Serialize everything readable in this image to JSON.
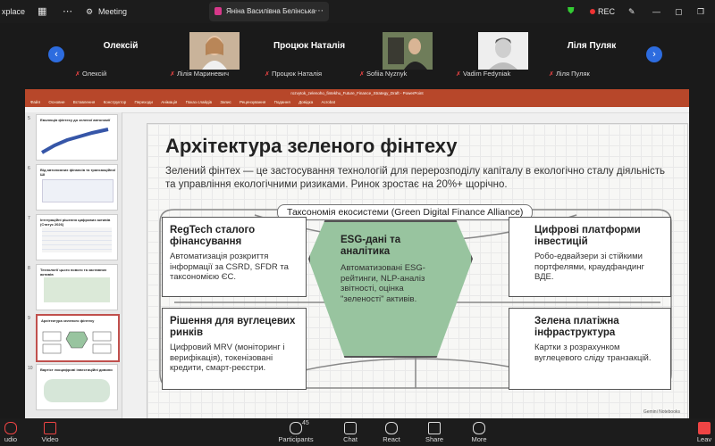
{
  "topbar": {
    "app_name": "xplace",
    "meeting_label": "Meeting",
    "tab_title": "Яніна Василівна Белінська's scr",
    "rec_label": "REC"
  },
  "gallery": {
    "participants": [
      {
        "name": "Олексій",
        "label": "Олексій",
        "has_photo": false
      },
      {
        "name": "",
        "label": "Лілія Мариневич",
        "has_photo": true
      },
      {
        "name": "Процюк Наталія",
        "label": "Процюк Наталія",
        "has_photo": false
      },
      {
        "name": "",
        "label": "Sofiia Nyznyk",
        "has_photo": true
      },
      {
        "name": "",
        "label": "Vadim Fedyniak",
        "has_photo": true
      },
      {
        "name": "Ліля Пуляк",
        "label": "Ліля Пуляк",
        "has_photo": false
      }
    ]
  },
  "ppt": {
    "title_bar": "rozvytok_zelenoho_fintekhu_Future_Finance_Strategy_Draft - PowerPoint",
    "menu_items": [
      "Файл",
      "Основне",
      "Вставлення",
      "Конструктор",
      "Переходи",
      "Анімація",
      "Показ слайдів",
      "Запис",
      "Рецензування",
      "Подання",
      "Довідка",
      "Acrobat"
    ]
  },
  "thumbs": [
    {
      "num": "5",
      "title": "Еволюція фінтеху до зеленої автономії"
    },
    {
      "num": "6",
      "title": "Від автономних фінансів та трансакційної ШІ"
    },
    {
      "num": "7",
      "title": "Інтеграційні рішення цифрових активів (Статус 2026)"
    },
    {
      "num": "8",
      "title": "Технології цього нового та заставних активів"
    },
    {
      "num": "9",
      "title": "Архітектура зеленого фінтеху"
    },
    {
      "num": "10",
      "title": "Вартіст екоцифрові інвестиційні дивини"
    }
  ],
  "slide": {
    "title": "Архітектура зеленого фінтеху",
    "subtitle": "Зелений фінтех — це застосування технологій для перерозподілу капіталу в екологічно сталу діяльність та управління екологічними ризиками. Ринок зростає на 20%+ щорічно.",
    "pill": "Таксономія екосистеми (Green Digital Finance Alliance)",
    "cards": {
      "regtech": {
        "title": "RegTech сталого фінансування",
        "text": "Автоматизація розкриття інформації за CSRD, SFDR та таксономією ЄС."
      },
      "esg": {
        "title": "ESG-дані та аналітика",
        "text": "Автоматизовані ESG-рейтинги, NLP-аналіз звітності, оцінка \"зеленості\" активів."
      },
      "platforms": {
        "title": "Цифрові платформи інвестицій",
        "text": "Робо-едвайзери зі стійкими портфелями, краудфандинг ВДЕ."
      },
      "carbon": {
        "title": "Рішення для вуглецевих ринків",
        "text": "Цифровий MRV (моніторинг і верифікація), токенізовані кредити, смарт-реєстри."
      },
      "payments": {
        "title": "Зелена платіжна інфраструктура",
        "text": "Картки з розрахунком вуглецевого сліду транзакцій."
      }
    },
    "gemini": "Gemini Notebooks"
  },
  "bottombar": {
    "audio": "udio",
    "video": "Video",
    "participants": "Participants",
    "participants_count": "45",
    "chat": "Chat",
    "react": "React",
    "share": "Share",
    "more": "More",
    "leave": "Leav"
  },
  "colors": {
    "accent": "#2d6cdf",
    "ppt_red": "#b7472a",
    "hex_green": "#98c49f"
  }
}
